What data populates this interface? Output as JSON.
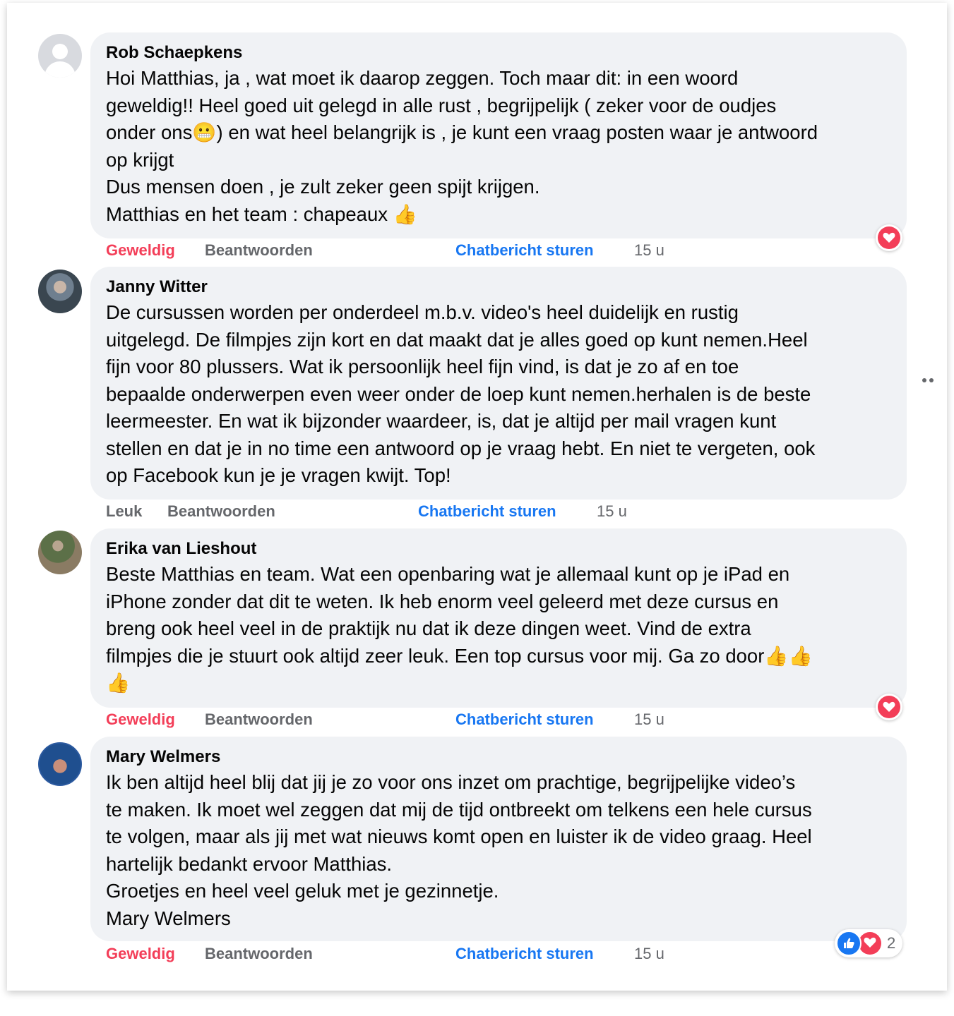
{
  "comments": [
    {
      "author": "Rob Schaepkens",
      "lines": [
        "Hoi Matthias, ja , wat moet ik daarop zeggen. Toch maar dit: in een woord",
        "geweldig!! Heel goed uit gelegd in alle rust , begrijpelijk ( zeker voor de oudjes",
        "onder ons😬) en wat heel belangrijk is , je kunt een vraag posten waar je antwoord",
        "op krijgt",
        "Dus mensen doen , je zult zeker geen spijt krijgen.",
        "Matthias en het team : chapeaux 👍"
      ],
      "react_label": "Geweldig",
      "reply_label": "Beantwoorden",
      "chat_label": "Chatbericht sturen",
      "time": "15 u"
    },
    {
      "author": "Janny Witter",
      "lines": [
        "De cursussen worden per onderdeel m.b.v. video's heel duidelijk en rustig",
        "uitgelegd. De filmpjes zijn kort en dat maakt dat je alles goed op kunt nemen.Heel",
        "fijn voor 80 plussers. Wat ik persoonlijk heel fijn vind, is dat je zo af en toe",
        "bepaalde onderwerpen even weer onder de loep kunt nemen.herhalen is de beste",
        "leermeester. En wat ik bijzonder waardeer, is, dat je altijd per mail vragen kunt",
        "stellen en dat je in no time een antwoord op je vraag hebt. En niet te vergeten, ook",
        "op Facebook kun je je vragen kwijt. Top!"
      ],
      "react_label": "Leuk",
      "reply_label": "Beantwoorden",
      "chat_label": "Chatbericht sturen",
      "time": "15 u"
    },
    {
      "author": "Erika van Lieshout",
      "lines": [
        "Beste Matthias en team. Wat een openbaring wat je allemaal kunt op je iPad en",
        "iPhone zonder dat dit te weten. Ik heb enorm veel geleerd met deze cursus en",
        "breng ook heel veel in de praktijk nu dat ik deze dingen weet. Vind de extra",
        "filmpjes die je stuurt ook altijd zeer leuk. Een top cursus voor mij. Ga zo door👍👍",
        "👍"
      ],
      "react_label": "Geweldig",
      "reply_label": "Beantwoorden",
      "chat_label": "Chatbericht sturen",
      "time": "15 u"
    },
    {
      "author": "Mary Welmers",
      "lines": [
        "Ik ben altijd heel blij dat jij je zo voor ons inzet om prachtige, begrijpelijke video’s",
        "te maken. Ik moet wel zeggen dat mij de tijd ontbreekt om telkens een hele cursus",
        "te volgen, maar als jij met wat nieuws komt open en luister ik de video graag. Heel",
        "hartelijk bedankt ervoor Matthias.",
        "Groetjes en heel veel geluk met je gezinnetje.",
        "Mary Welmers"
      ],
      "react_label": "Geweldig",
      "reply_label": "Beantwoorden",
      "chat_label": "Chatbericht sturen",
      "time": "15 u",
      "reaction_count": "2"
    }
  ],
  "colors": {
    "bubble": "#f0f2f5",
    "love": "#f33e58",
    "like": "#1877f2",
    "secondary_text": "#65676b"
  },
  "icons": {
    "love_reaction": "heart-icon",
    "like_reaction": "thumbs-up-icon",
    "more": "more-dots-icon"
  }
}
